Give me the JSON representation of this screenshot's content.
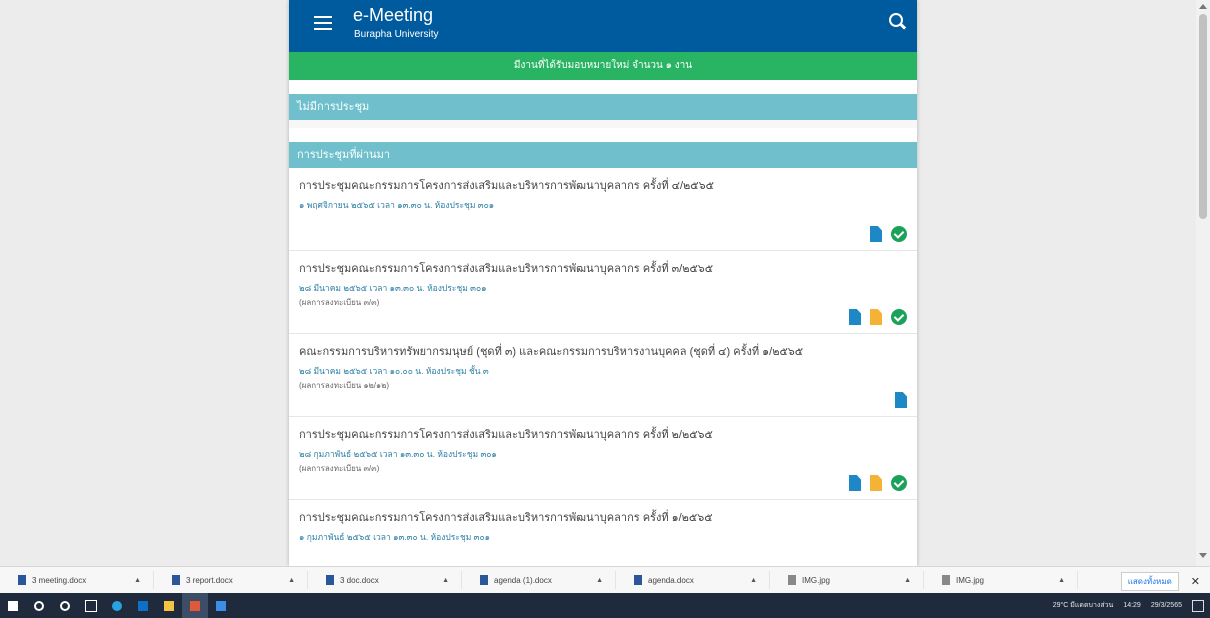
{
  "window": {
    "bg": "#ececec"
  },
  "app": {
    "title": "e-Meeting",
    "subtitle": "Burapha University",
    "notice": "มีงานที่ได้รับมอบหมายใหม่ จำนวน ๑ งาน"
  },
  "sections": {
    "no_meeting_label": "ไม่มีการประชุม",
    "past_label": "การประชุมที่ผ่านมา"
  },
  "meetings": [
    {
      "title": "การประชุมคณะกรรมการโครงการส่งเสริมและบริหารการพัฒนาบุคลากร ครั้งที่ ๔/๒๕๖๕",
      "date": "๑ พฤศจิกายน ๒๕๖๕ เวลา ๑๓.๓๐ น. ห้องประชุม ๓๐๑",
      "note": ""
    },
    {
      "title": "การประชุมคณะกรรมการโครงการส่งเสริมและบริหารการพัฒนาบุคลากร ครั้งที่ ๓/๒๕๖๕",
      "date": "๒๘ มีนาคม ๒๕๖๕ เวลา ๑๓.๓๐ น. ห้องประชุม ๓๐๑",
      "note": "(ผลการลงทะเบียน ๓/๓)"
    },
    {
      "title": "คณะกรรมการบริหารทรัพยากรมนุษย์ (ชุดที่ ๓) และคณะกรรมการบริหารงานบุคคล (ชุดที่ ๔) ครั้งที่ ๑/๒๕๖๕",
      "date": "๒๘ มีนาคม ๒๕๖๕ เวลา ๑๐.๐๐ น. ห้องประชุม ชั้น ๓",
      "note": "(ผลการลงทะเบียน ๑๒/๑๒)"
    },
    {
      "title": "การประชุมคณะกรรมการโครงการส่งเสริมและบริหารการพัฒนาบุคลากร ครั้งที่ ๒/๒๕๖๕",
      "date": "๒๘ กุมภาพันธ์ ๒๕๖๕ เวลา ๑๓.๓๐ น. ห้องประชุม ๓๐๑",
      "note": "(ผลการลงทะเบียน ๓/๓)"
    },
    {
      "title": "การประชุมคณะกรรมการโครงการส่งเสริมและบริหารการพัฒนาบุคลากร ครั้งที่ ๑/๒๕๖๕",
      "date": "๑ กุมภาพันธ์ ๒๕๖๕ เวลา ๑๓.๓๐ น. ห้องประชุม ๓๐๑",
      "note": ""
    }
  ],
  "downloads": [
    {
      "name": "3 meeting.docx"
    },
    {
      "name": "3 report.docx"
    },
    {
      "name": "3 doc.docx"
    },
    {
      "name": "agenda (1).docx"
    },
    {
      "name": "agenda.docx"
    },
    {
      "name": "IMG.jpg"
    },
    {
      "name": "IMG.jpg"
    }
  ],
  "download_bar": {
    "show_all": "แสดงทั้งหมด",
    "close": "✕"
  },
  "taskbar": {
    "weather": "29°C มีแดดบางส่วน",
    "time": "14:29",
    "date": "29/3/2565"
  }
}
